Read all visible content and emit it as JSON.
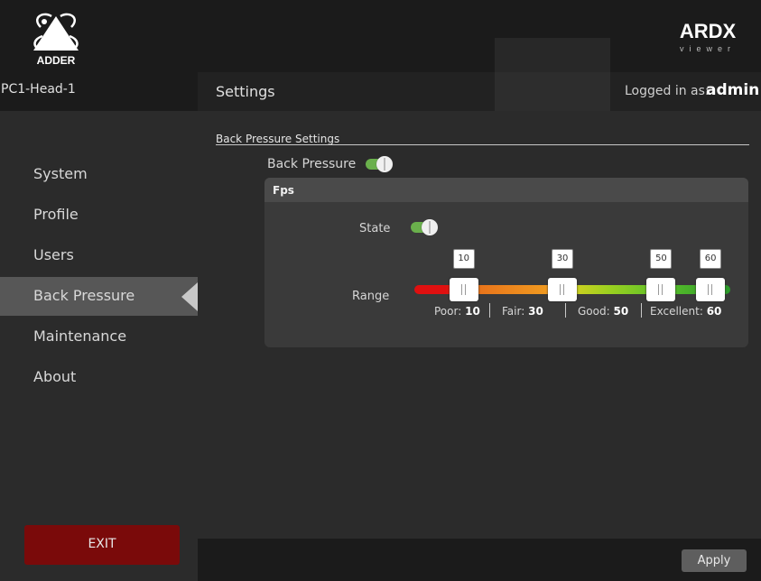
{
  "brand": {
    "logo_text": "ADDER",
    "product_logo": "ARDX",
    "product_sub": "viewer"
  },
  "device": {
    "name": "PC1-Head-1"
  },
  "header": {
    "title": "Settings",
    "login_label": "Logged in as:",
    "login_user": "admin"
  },
  "sidebar": {
    "items": [
      {
        "label": "System",
        "active": false
      },
      {
        "label": "Profile",
        "active": false
      },
      {
        "label": "Users",
        "active": false
      },
      {
        "label": "Back Pressure",
        "active": true
      },
      {
        "label": "Maintenance",
        "active": false
      },
      {
        "label": "About",
        "active": false
      }
    ],
    "exit_label": "EXIT"
  },
  "settings": {
    "section_title": "Back Pressure Settings",
    "back_pressure_label": "Back Pressure",
    "back_pressure_enabled": true,
    "fps": {
      "title": "Fps",
      "state_label": "State",
      "state_enabled": true,
      "range_label": "Range",
      "range_min": 0,
      "range_max": 64,
      "thumbs": [
        "10",
        "30",
        "50",
        "60"
      ],
      "legend": [
        {
          "label": "Poor:",
          "value": "10"
        },
        {
          "label": "Fair:",
          "value": "30"
        },
        {
          "label": "Good:",
          "value": "50"
        },
        {
          "label": "Excellent:",
          "value": "60"
        }
      ]
    }
  },
  "footer": {
    "apply_label": "Apply"
  },
  "colors": {
    "accent_green": "#6ab04c",
    "exit_red": "#7a0a0a",
    "active_nav": "#575757"
  }
}
